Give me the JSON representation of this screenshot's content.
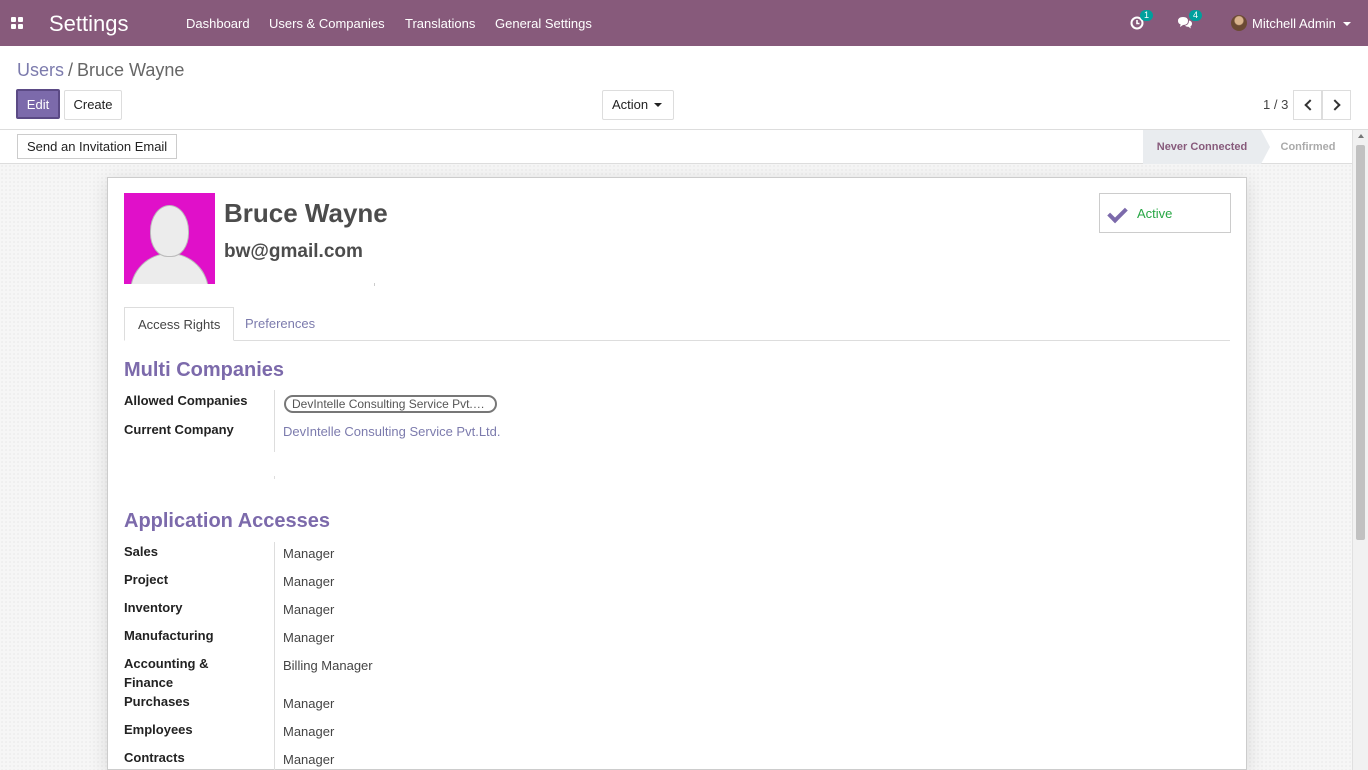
{
  "app": {
    "title": "Settings",
    "menu": [
      "Dashboard",
      "Users & Companies",
      "Translations",
      "General Settings"
    ],
    "activity_count": "1",
    "message_count": "4",
    "user_name": "Mitchell Admin"
  },
  "breadcrumb": {
    "parent": "Users",
    "separator": "/",
    "current": "Bruce Wayne"
  },
  "buttons": {
    "edit": "Edit",
    "create": "Create",
    "action": "Action",
    "invite": "Send an Invitation Email"
  },
  "pager": {
    "value": "1 / 3"
  },
  "statusbar": {
    "stages": [
      "Never Connected",
      "Confirmed"
    ],
    "current_stage": "Never Connected"
  },
  "record": {
    "name": "Bruce Wayne",
    "email": "bw@gmail.com",
    "active_label": "Active"
  },
  "tabs": [
    "Access Rights",
    "Preferences"
  ],
  "multi_companies": {
    "title": "Multi Companies",
    "allowed_label": "Allowed Companies",
    "allowed_tag": "DevIntelle Consulting Service Pvt.L...",
    "current_label": "Current Company",
    "current_value": "DevIntelle Consulting Service Pvt.Ltd."
  },
  "app_access": {
    "title": "Application Accesses",
    "rows": [
      {
        "label": "Sales",
        "value": "Manager"
      },
      {
        "label": "Project",
        "value": "Manager"
      },
      {
        "label": "Inventory",
        "value": "Manager"
      },
      {
        "label": "Manufacturing",
        "value": "Manager"
      },
      {
        "label": "Accounting & Finance",
        "value": "Billing Manager"
      },
      {
        "label": "Purchases",
        "value": "Manager"
      },
      {
        "label": "Employees",
        "value": "Manager"
      },
      {
        "label": "Contracts",
        "value": "Manager"
      }
    ]
  },
  "colors": {
    "brand": "#875a7b",
    "primary_button": "#7c6aab",
    "link": "#7c7bad",
    "active_green": "#28a745",
    "badge": "#00a09d",
    "avatar_bg": "#e010c9"
  }
}
